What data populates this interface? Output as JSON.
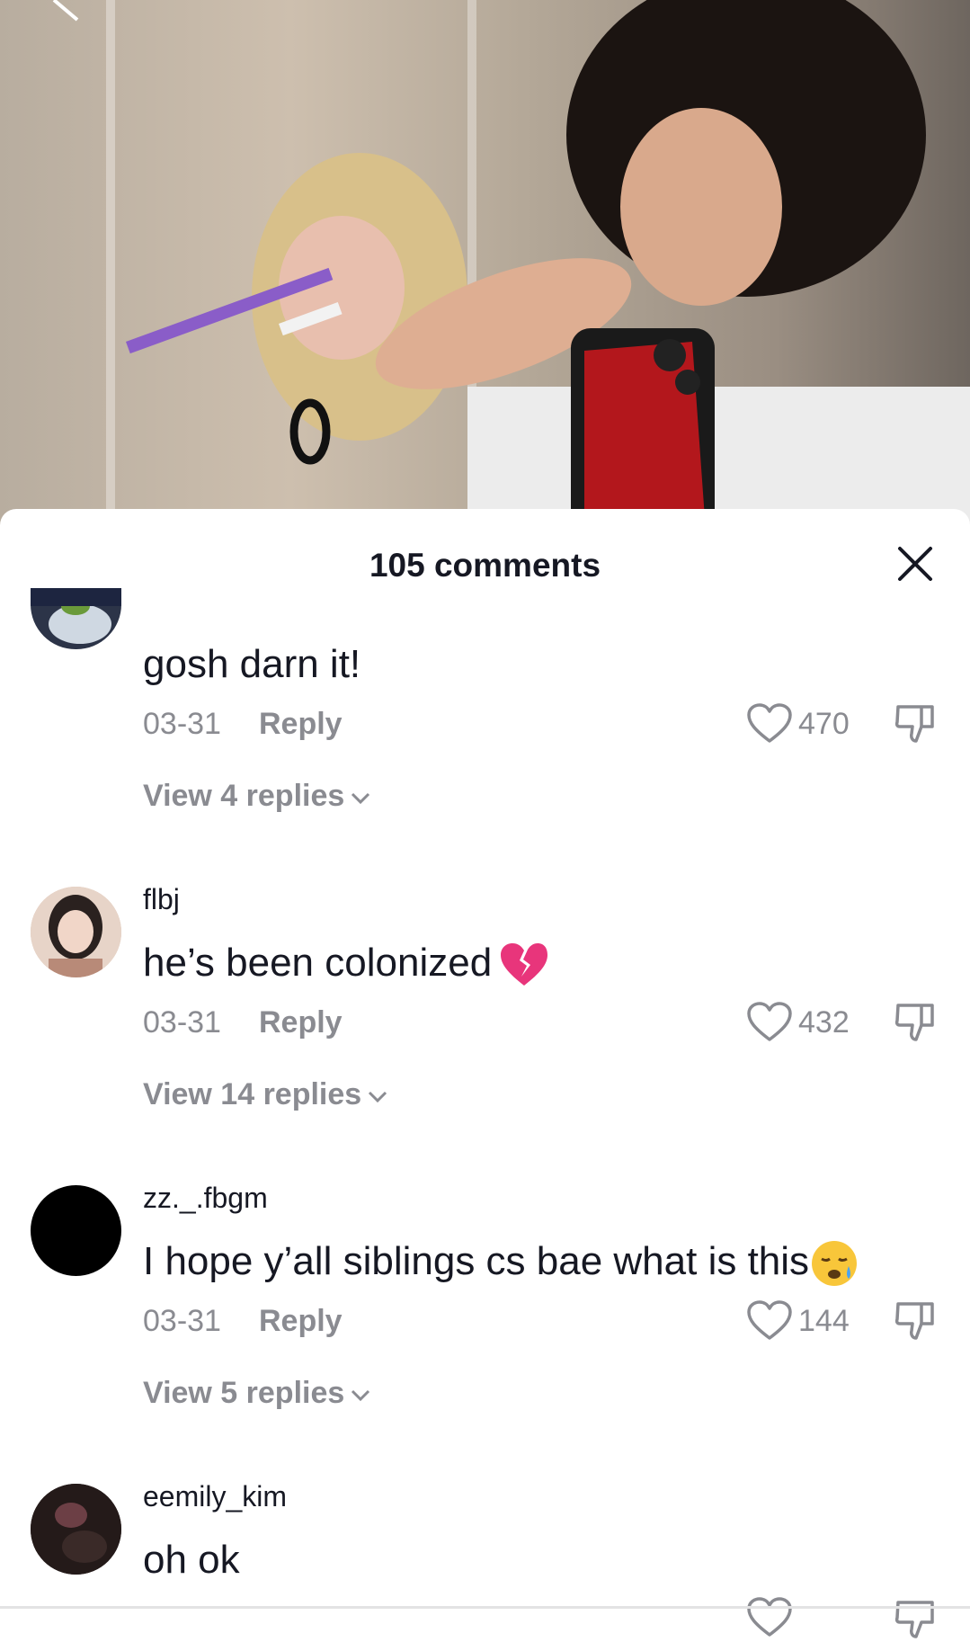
{
  "video": {
    "description_icon": "photo"
  },
  "sheet": {
    "title": "105 comments"
  },
  "comments": [
    {
      "username": "",
      "text": "gosh darn it!",
      "date": "03-31",
      "reply_label": "Reply",
      "likes": "470",
      "view_replies": "View 4 replies"
    },
    {
      "username": "flbj",
      "text": "he’s been colonized",
      "emoji": "broken-heart-icon",
      "date": "03-31",
      "reply_label": "Reply",
      "likes": "432",
      "view_replies": "View 14 replies"
    },
    {
      "username": "zz._.fbgm",
      "text": "I hope y’all siblings cs bae what is this",
      "emoji": "sad-face-icon",
      "date": "03-31",
      "reply_label": "Reply",
      "likes": "144",
      "view_replies": "View 5 replies"
    },
    {
      "username": "eemily_kim",
      "text": "oh ok"
    }
  ],
  "colors": {
    "text_primary": "#161823",
    "text_secondary": "#8a8b91",
    "sheet_bg": "#ffffff"
  }
}
